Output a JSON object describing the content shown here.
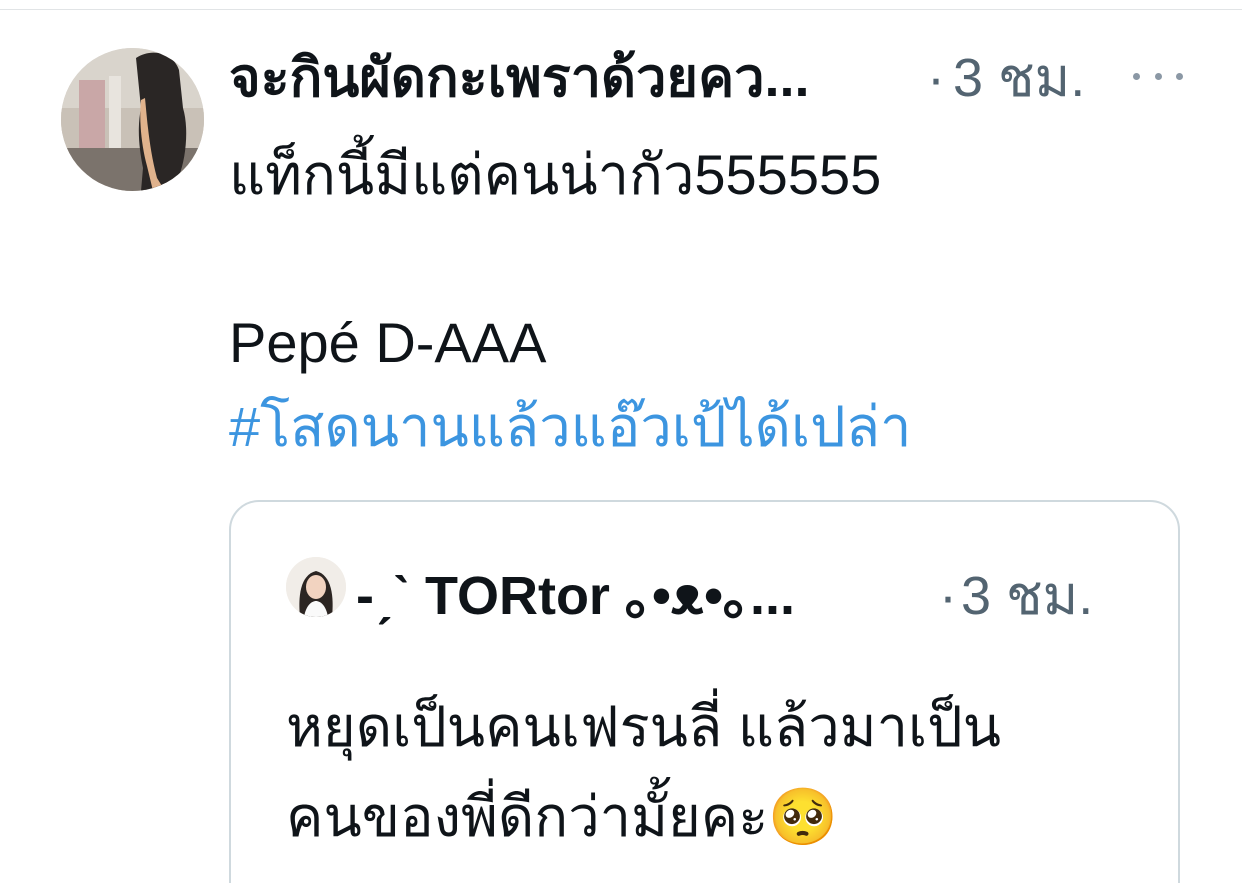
{
  "tweet": {
    "author_name": "จะกินผัดกะเพราด้วยคว...",
    "separator": "·",
    "time": "3 ชม.",
    "more_icon": "more-horizontal-icon",
    "text_line1": "แท็กนี้มีแต่คนน่ากัว555555",
    "text_line2": "Pepé D-AAA",
    "hashtag": "#โสดนานแล้วแอ๊วเป้ได้เปล่า"
  },
  "quote": {
    "author_name": "-ˏˋ TORtor ｡•ᴥ•｡...",
    "separator": "·",
    "time": "3 ชม.",
    "text_line1": "หยุดเป็นคนเฟรนลี่ แล้วมาเป็น",
    "text_line2": "คนของพี่ดีกว่ามั้ยคะ🥺"
  },
  "colors": {
    "text_primary": "#0f1419",
    "text_secondary": "#536471",
    "link": "#3c95e0",
    "border": "#cfd9de"
  }
}
